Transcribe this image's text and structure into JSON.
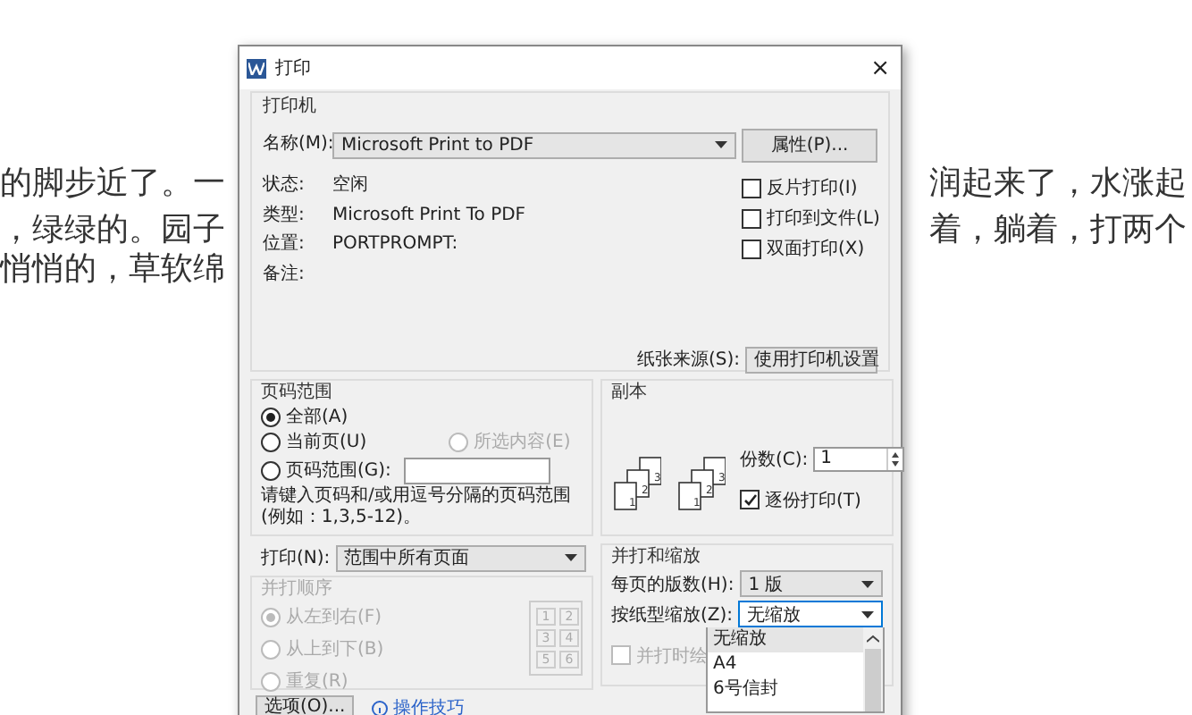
{
  "document": {
    "lines": [
      {
        "left": "的脚步近了。一",
        "right": "润起来了，水涨起"
      },
      {
        "left": "，绿绿的。园子",
        "right": "着，躺着，打两个"
      },
      {
        "left": "悄悄的，草软绵"
      }
    ]
  },
  "dialog": {
    "title": "打印",
    "close": "×",
    "printer": {
      "legend": "打印机",
      "name_label": "名称(M):",
      "name": "Microsoft Print to PDF",
      "properties_button": "属性(P)...",
      "info": [
        {
          "label": "状态:",
          "value": "空闲"
        },
        {
          "label": "类型:",
          "value": "Microsoft Print To PDF"
        },
        {
          "label": "位置:",
          "value": "PORTPROMPT:"
        },
        {
          "label": "备注:"
        }
      ],
      "options": [
        {
          "label": "反片打印(I)",
          "checked": false
        },
        {
          "label": "打印到文件(L)",
          "checked": false
        },
        {
          "label": "双面打印(X)",
          "checked": false
        }
      ],
      "source_label": "纸张来源(S):",
      "source": "使用打印机设置"
    },
    "page_range": {
      "legend": "页码范围",
      "choices": [
        {
          "label": "全部(A)",
          "selected": true,
          "disabled": false
        },
        {
          "label": "当前页(U)",
          "selected": false,
          "disabled": false
        },
        {
          "label": "所选内容(E)",
          "selected": false,
          "disabled": true
        },
        {
          "label": "页码范围(G):",
          "selected": false,
          "disabled": false
        }
      ],
      "hint": "请键入页码和/或用逗号分隔的页码范围(例如：1,3,5-12)。"
    },
    "copies": {
      "legend": "副本",
      "collate_icons": [
        [
          "1",
          "2",
          "3"
        ],
        [
          "1",
          "2",
          "3"
        ]
      ],
      "count_label": "份数(C):",
      "count": "1",
      "collate_label": "逐份打印(T)",
      "collate": true
    },
    "print_what": {
      "label": "打印(N):",
      "value": "范围中所有页面"
    },
    "order": {
      "legend": "并打顺序",
      "disabled": true,
      "choices": [
        {
          "label": "从左到右(F)",
          "selected": true
        },
        {
          "label": "从上到下(B)",
          "selected": false
        },
        {
          "label": "重复(R)",
          "selected": false
        }
      ],
      "grid": [
        "1",
        "2",
        "3",
        "4",
        "5",
        "6"
      ]
    },
    "scale": {
      "legend": "并打和缩放",
      "per_page_label": "每页的版数(H):",
      "per_page": "1 版",
      "fit_label": "按纸型缩放(Z):",
      "fit": "无缩放",
      "draw_borders_label": "并打时绘",
      "draw_borders": false,
      "draw_borders_disabled": true,
      "list": [
        {
          "label": "无缩放",
          "selected": true
        },
        {
          "label": "A4",
          "selected": false
        },
        {
          "label": "6号信封",
          "selected": false
        }
      ]
    },
    "footer": {
      "options_button": "选项(O)...",
      "tips_link": "操作技巧"
    }
  }
}
